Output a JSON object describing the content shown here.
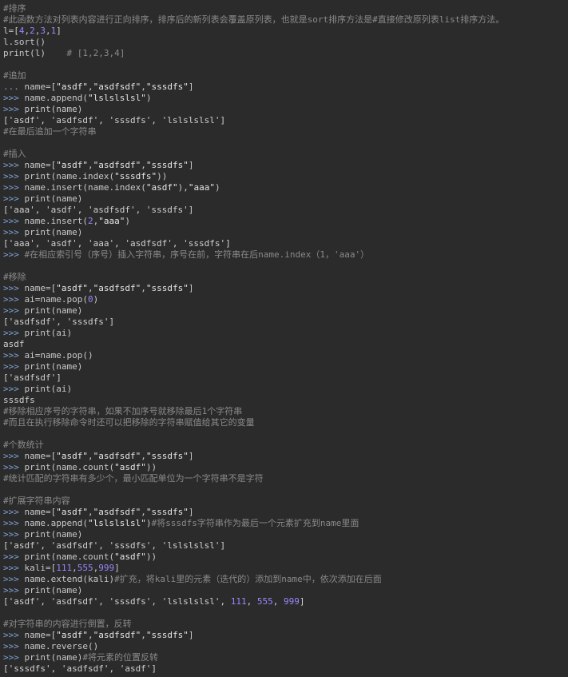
{
  "editor": {
    "colors": {
      "background": "#2b2b2b",
      "comment": "#8a8a8a",
      "prompt": "#7fa2d6",
      "string": "#e6e6e6",
      "number": "#9a86fd",
      "plain": "#c8c8c8",
      "output": "#d0d0d0"
    },
    "lines": [
      [
        {
          "t": "comment",
          "v": "#排序"
        }
      ],
      [
        {
          "t": "comment",
          "v": "#此函数方法对列表内容进行正向排序，排序后的新列表会覆盖原列表，也就是sort排序方法是#直接修改原列表list排序方法。"
        }
      ],
      [
        {
          "t": "plain",
          "v": "l=["
        },
        {
          "t": "number",
          "v": "4"
        },
        {
          "t": "plain",
          "v": ","
        },
        {
          "t": "number",
          "v": "2"
        },
        {
          "t": "plain",
          "v": ","
        },
        {
          "t": "number",
          "v": "3"
        },
        {
          "t": "plain",
          "v": ","
        },
        {
          "t": "number",
          "v": "1"
        },
        {
          "t": "plain",
          "v": "]"
        }
      ],
      [
        {
          "t": "plain",
          "v": "l.sort()"
        }
      ],
      [
        {
          "t": "plain",
          "v": "print(l)    "
        },
        {
          "t": "comment",
          "v": "# [1,2,3,4]"
        }
      ],
      [],
      [
        {
          "t": "comment",
          "v": "#追加"
        }
      ],
      [
        {
          "t": "prompt",
          "v": "... "
        },
        {
          "t": "plain",
          "v": "name=["
        },
        {
          "t": "string",
          "v": "\"asdf\""
        },
        {
          "t": "plain",
          "v": ","
        },
        {
          "t": "string",
          "v": "\"asdfsdf\""
        },
        {
          "t": "plain",
          "v": ","
        },
        {
          "t": "string",
          "v": "\"sssdfs\""
        },
        {
          "t": "plain",
          "v": "]"
        }
      ],
      [
        {
          "t": "prompt",
          "v": ">>> "
        },
        {
          "t": "plain",
          "v": "name.append("
        },
        {
          "t": "string",
          "v": "\"lslslslsl\""
        },
        {
          "t": "plain",
          "v": ")"
        }
      ],
      [
        {
          "t": "prompt",
          "v": ">>> "
        },
        {
          "t": "plain",
          "v": "print(name)"
        }
      ],
      [
        {
          "t": "output",
          "v": "['asdf', 'asdfsdf', 'sssdfs', 'lslslslsl']"
        }
      ],
      [
        {
          "t": "comment",
          "v": "#在最后追加一个字符串"
        }
      ],
      [],
      [
        {
          "t": "comment",
          "v": "#插入"
        }
      ],
      [
        {
          "t": "prompt",
          "v": ">>> "
        },
        {
          "t": "plain",
          "v": "name=["
        },
        {
          "t": "string",
          "v": "\"asdf\""
        },
        {
          "t": "plain",
          "v": ","
        },
        {
          "t": "string",
          "v": "\"asdfsdf\""
        },
        {
          "t": "plain",
          "v": ","
        },
        {
          "t": "string",
          "v": "\"sssdfs\""
        },
        {
          "t": "plain",
          "v": "]"
        }
      ],
      [
        {
          "t": "prompt",
          "v": ">>> "
        },
        {
          "t": "plain",
          "v": "print(name.index("
        },
        {
          "t": "string",
          "v": "\"sssdfs\""
        },
        {
          "t": "plain",
          "v": "))"
        }
      ],
      [
        {
          "t": "prompt",
          "v": ">>> "
        },
        {
          "t": "plain",
          "v": "name.insert(name.index("
        },
        {
          "t": "string",
          "v": "\"asdf\""
        },
        {
          "t": "plain",
          "v": "),"
        },
        {
          "t": "string",
          "v": "\"aaa\""
        },
        {
          "t": "plain",
          "v": ")"
        }
      ],
      [
        {
          "t": "prompt",
          "v": ">>> "
        },
        {
          "t": "plain",
          "v": "print(name)"
        }
      ],
      [
        {
          "t": "output",
          "v": "['aaa', 'asdf', 'asdfsdf', 'sssdfs']"
        }
      ],
      [
        {
          "t": "prompt",
          "v": ">>> "
        },
        {
          "t": "plain",
          "v": "name.insert("
        },
        {
          "t": "number",
          "v": "2"
        },
        {
          "t": "plain",
          "v": ","
        },
        {
          "t": "string",
          "v": "\"aaa\""
        },
        {
          "t": "plain",
          "v": ")"
        }
      ],
      [
        {
          "t": "prompt",
          "v": ">>> "
        },
        {
          "t": "plain",
          "v": "print(name)"
        }
      ],
      [
        {
          "t": "output",
          "v": "['aaa', 'asdf', 'aaa', 'asdfsdf', 'sssdfs']"
        }
      ],
      [
        {
          "t": "prompt",
          "v": ">>> "
        },
        {
          "t": "comment",
          "v": "#在相应索引号（序号）插入字符串，序号在前，字符串在后name.index（1，'aaa'）"
        }
      ],
      [],
      [
        {
          "t": "comment",
          "v": "#移除"
        }
      ],
      [
        {
          "t": "prompt",
          "v": ">>> "
        },
        {
          "t": "plain",
          "v": "name=["
        },
        {
          "t": "string",
          "v": "\"asdf\""
        },
        {
          "t": "plain",
          "v": ","
        },
        {
          "t": "string",
          "v": "\"asdfsdf\""
        },
        {
          "t": "plain",
          "v": ","
        },
        {
          "t": "string",
          "v": "\"sssdfs\""
        },
        {
          "t": "plain",
          "v": "]"
        }
      ],
      [
        {
          "t": "prompt",
          "v": ">>> "
        },
        {
          "t": "plain",
          "v": "ai=name.pop("
        },
        {
          "t": "number",
          "v": "0"
        },
        {
          "t": "plain",
          "v": ")"
        }
      ],
      [
        {
          "t": "prompt",
          "v": ">>> "
        },
        {
          "t": "plain",
          "v": "print(name)"
        }
      ],
      [
        {
          "t": "output",
          "v": "['asdfsdf', 'sssdfs']"
        }
      ],
      [
        {
          "t": "prompt",
          "v": ">>> "
        },
        {
          "t": "plain",
          "v": "print(ai)"
        }
      ],
      [
        {
          "t": "output",
          "v": "asdf"
        }
      ],
      [
        {
          "t": "prompt",
          "v": ">>> "
        },
        {
          "t": "plain",
          "v": "ai=name.pop()"
        }
      ],
      [
        {
          "t": "prompt",
          "v": ">>> "
        },
        {
          "t": "plain",
          "v": "print(name)"
        }
      ],
      [
        {
          "t": "output",
          "v": "['asdfsdf']"
        }
      ],
      [
        {
          "t": "prompt",
          "v": ">>> "
        },
        {
          "t": "plain",
          "v": "print(ai)"
        }
      ],
      [
        {
          "t": "output",
          "v": "sssdfs"
        }
      ],
      [
        {
          "t": "comment",
          "v": "#移除相应序号的字符串，如果不加序号就移除最后1个字符串"
        }
      ],
      [
        {
          "t": "comment",
          "v": "#而且在执行移除命令时还可以把移除的字符串赋值给其它的变量"
        }
      ],
      [],
      [
        {
          "t": "comment",
          "v": "#个数统计"
        }
      ],
      [
        {
          "t": "prompt",
          "v": ">>> "
        },
        {
          "t": "plain",
          "v": "name=["
        },
        {
          "t": "string",
          "v": "\"asdf\""
        },
        {
          "t": "plain",
          "v": ","
        },
        {
          "t": "string",
          "v": "\"asdfsdf\""
        },
        {
          "t": "plain",
          "v": ","
        },
        {
          "t": "string",
          "v": "\"sssdfs\""
        },
        {
          "t": "plain",
          "v": "]"
        }
      ],
      [
        {
          "t": "prompt",
          "v": ">>> "
        },
        {
          "t": "plain",
          "v": "print(name.count("
        },
        {
          "t": "string",
          "v": "\"asdf\""
        },
        {
          "t": "plain",
          "v": "))"
        }
      ],
      [
        {
          "t": "comment",
          "v": "#统计匹配的字符串有多少个，最小匹配单位为一个字符串不是字符"
        }
      ],
      [],
      [
        {
          "t": "comment",
          "v": "#扩展字符串内容"
        }
      ],
      [
        {
          "t": "prompt",
          "v": ">>> "
        },
        {
          "t": "plain",
          "v": "name=["
        },
        {
          "t": "string",
          "v": "\"asdf\""
        },
        {
          "t": "plain",
          "v": ","
        },
        {
          "t": "string",
          "v": "\"asdfsdf\""
        },
        {
          "t": "plain",
          "v": ","
        },
        {
          "t": "string",
          "v": "\"sssdfs\""
        },
        {
          "t": "plain",
          "v": "]"
        }
      ],
      [
        {
          "t": "prompt",
          "v": ">>> "
        },
        {
          "t": "plain",
          "v": "name.append("
        },
        {
          "t": "string",
          "v": "\"lslslslsl\""
        },
        {
          "t": "plain",
          "v": ")"
        },
        {
          "t": "comment",
          "v": "#将sssdfs字符串作为最后一个元素扩充到name里面"
        }
      ],
      [
        {
          "t": "prompt",
          "v": ">>> "
        },
        {
          "t": "plain",
          "v": "print(name)"
        }
      ],
      [
        {
          "t": "output",
          "v": "['asdf', 'asdfsdf', 'sssdfs', 'lslslslsl']"
        }
      ],
      [
        {
          "t": "prompt",
          "v": ">>> "
        },
        {
          "t": "plain",
          "v": "print(name.count("
        },
        {
          "t": "string",
          "v": "\"asdf\""
        },
        {
          "t": "plain",
          "v": "))"
        }
      ],
      [
        {
          "t": "prompt",
          "v": ">>> "
        },
        {
          "t": "plain",
          "v": "kali=["
        },
        {
          "t": "number",
          "v": "111"
        },
        {
          "t": "plain",
          "v": ","
        },
        {
          "t": "number",
          "v": "555"
        },
        {
          "t": "plain",
          "v": ","
        },
        {
          "t": "number",
          "v": "999"
        },
        {
          "t": "plain",
          "v": "]"
        }
      ],
      [
        {
          "t": "prompt",
          "v": ">>> "
        },
        {
          "t": "plain",
          "v": "name.extend(kali)"
        },
        {
          "t": "comment",
          "v": "#扩充，将kali里的元素（迭代的）添加到name中，依次添加在后面"
        }
      ],
      [
        {
          "t": "prompt",
          "v": ">>> "
        },
        {
          "t": "plain",
          "v": "print(name)"
        }
      ],
      [
        {
          "t": "output",
          "v": "['asdf', 'asdfsdf', 'sssdfs', 'lslslslsl', "
        },
        {
          "t": "number",
          "v": "111"
        },
        {
          "t": "output",
          "v": ", "
        },
        {
          "t": "number",
          "v": "555"
        },
        {
          "t": "output",
          "v": ", "
        },
        {
          "t": "number",
          "v": "999"
        },
        {
          "t": "output",
          "v": "]"
        }
      ],
      [],
      [
        {
          "t": "comment",
          "v": "#对字符串的内容进行倒置，反转"
        }
      ],
      [
        {
          "t": "prompt",
          "v": ">>> "
        },
        {
          "t": "plain",
          "v": "name=["
        },
        {
          "t": "string",
          "v": "\"asdf\""
        },
        {
          "t": "plain",
          "v": ","
        },
        {
          "t": "string",
          "v": "\"asdfsdf\""
        },
        {
          "t": "plain",
          "v": ","
        },
        {
          "t": "string",
          "v": "\"sssdfs\""
        },
        {
          "t": "plain",
          "v": "]"
        }
      ],
      [
        {
          "t": "prompt",
          "v": ">>> "
        },
        {
          "t": "plain",
          "v": "name.reverse()"
        }
      ],
      [
        {
          "t": "prompt",
          "v": ">>> "
        },
        {
          "t": "plain",
          "v": "print(name)"
        },
        {
          "t": "comment",
          "v": "#将元素的位置反转"
        }
      ],
      [
        {
          "t": "output",
          "v": "['sssdfs', 'asdfsdf', 'asdf']"
        }
      ]
    ]
  }
}
